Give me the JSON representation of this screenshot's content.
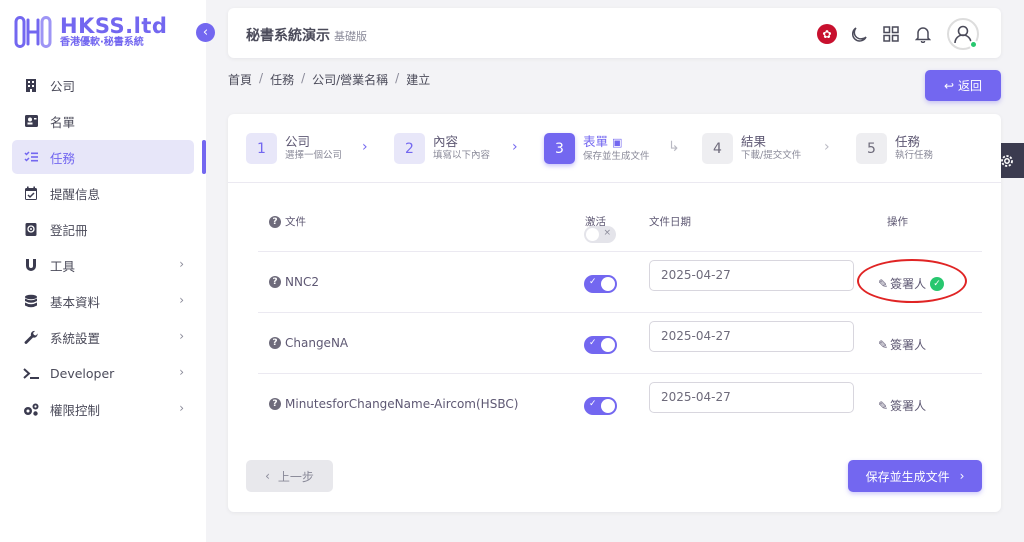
{
  "brand": {
    "title": "HKSS.ltd",
    "subtitle": "香港優軟·秘書系統",
    "accent": "#7367f0"
  },
  "sidebar": {
    "items": [
      {
        "label": "公司",
        "icon": "building-icon",
        "has_children": false
      },
      {
        "label": "名單",
        "icon": "contact-card-icon",
        "has_children": false
      },
      {
        "label": "任務",
        "icon": "checklist-icon",
        "has_children": false,
        "active": true
      },
      {
        "label": "提醒信息",
        "icon": "calendar-check-icon",
        "has_children": false
      },
      {
        "label": "登記冊",
        "icon": "register-book-icon",
        "has_children": false
      },
      {
        "label": "工具",
        "icon": "magnet-icon",
        "has_children": true
      },
      {
        "label": "基本資料",
        "icon": "database-icon",
        "has_children": true
      },
      {
        "label": "系統設置",
        "icon": "wrench-icon",
        "has_children": true
      },
      {
        "label": "Developer",
        "icon": "terminal-icon",
        "has_children": true
      },
      {
        "label": "權限控制",
        "icon": "gears-icon",
        "has_children": true
      }
    ]
  },
  "header": {
    "title": "秘書系統演示",
    "edition": "基礎版",
    "icons": [
      "hk-flag-icon",
      "moon-icon",
      "grid-icon",
      "bell-icon",
      "user-avatar-icon"
    ]
  },
  "breadcrumb": [
    "首頁",
    "任務",
    "公司/營業名稱",
    "建立"
  ],
  "actions": {
    "back_label": "返回",
    "prev_label": "上一步",
    "save_label": "保存並生成文件"
  },
  "stepper": [
    {
      "num": "1",
      "title": "公司",
      "desc": "選擇一個公司"
    },
    {
      "num": "2",
      "title": "內容",
      "desc": "填寫以下內容"
    },
    {
      "num": "3",
      "title": "表單",
      "desc": "保存並生成文件",
      "active": true
    },
    {
      "num": "4",
      "title": "結果",
      "desc": "下載/提交文件"
    },
    {
      "num": "5",
      "title": "任務",
      "desc": "執行任務"
    }
  ],
  "table": {
    "headers": {
      "document": "文件",
      "active": "激活",
      "date": "文件日期",
      "action": "操作"
    },
    "rows": [
      {
        "name": "NNC2",
        "active": true,
        "date": "2025-04-27",
        "action": "簽署人",
        "signed": true
      },
      {
        "name": "ChangeNA",
        "active": true,
        "date": "2025-04-27",
        "action": "簽署人",
        "signed": false
      },
      {
        "name": "MinutesforChangeName-Aircom(HSBC)",
        "active": true,
        "date": "2025-04-27",
        "action": "簽署人",
        "signed": false
      }
    ]
  }
}
